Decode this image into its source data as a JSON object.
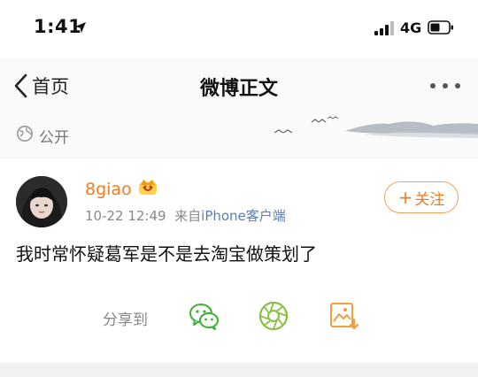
{
  "status_bar": {
    "time": "1:41",
    "network": "4G",
    "icons": [
      "location-arrow-icon",
      "signal-bars-icon",
      "battery-icon"
    ]
  },
  "nav": {
    "back_label": "首页",
    "title": "微博正文",
    "more_icon": "more-dots-icon"
  },
  "visibility": {
    "label": "公开",
    "icon": "globe-icon"
  },
  "post": {
    "username": "8giao",
    "vip_icon": "vip-crown-icon",
    "date": "10-22 12:49",
    "source_prefix": "来自",
    "source": "iPhone客户端",
    "follow_label": "关注",
    "text": "我时常怀疑葛军是不是去淘宝做策划了"
  },
  "share": {
    "label": "分享到",
    "targets": [
      "wechat-icon",
      "moments-icon",
      "save-image-icon"
    ]
  },
  "colors": {
    "accent": "#f47a20",
    "wechat": "#3cb034",
    "moments": "#86c23f",
    "link": "#5a7db0"
  }
}
